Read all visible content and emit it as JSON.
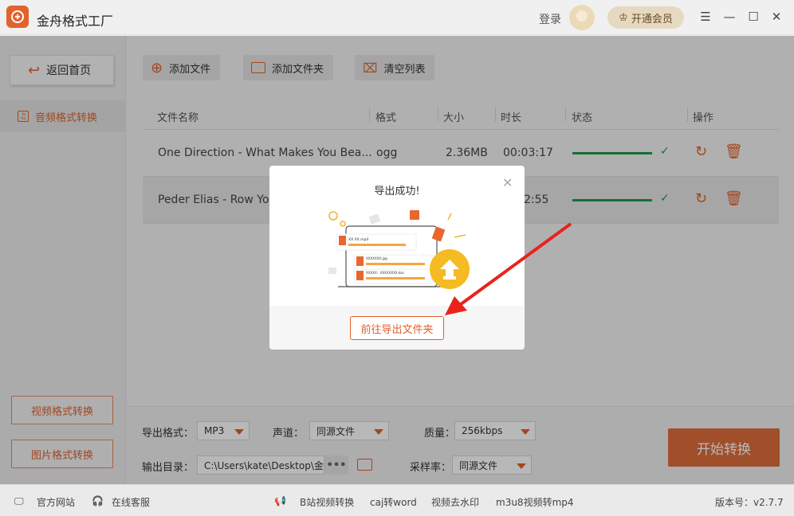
{
  "app": {
    "title": "金舟格式工厂",
    "login": "登录",
    "vip": "开通会员"
  },
  "sidebar": {
    "home": "返回首页",
    "active": "音频格式转换",
    "video": "视频格式转换",
    "image": "图片格式转换"
  },
  "toolbar": {
    "add_file": "添加文件",
    "add_folder": "添加文件夹",
    "clear": "清空列表"
  },
  "table": {
    "headers": {
      "name": "文件名称",
      "format": "格式",
      "size": "大小",
      "duration": "时长",
      "status": "状态",
      "action": "操作"
    },
    "rows": [
      {
        "name": "One Direction - What Makes You Bea...",
        "format": "ogg",
        "size": "2.36MB",
        "duration": "00:03:17",
        "progress": 1.0
      },
      {
        "name": "Peder Elias - Row You",
        "duration": "2:55",
        "progress": 1.0
      }
    ]
  },
  "settings": {
    "format_label": "导出格式：",
    "format_value": "MP3",
    "channel_label": "声道：",
    "channel_value": "同源文件",
    "quality_label": "质量：",
    "quality_value": "256kbps",
    "output_label": "输出目录：",
    "output_value": "C:\\Users\\kate\\Desktop\\金",
    "rate_label": "采样率：",
    "rate_value": "同源文件",
    "start": "开始转换"
  },
  "footer": {
    "site": "官方网站",
    "service": "在线客服",
    "bili": "B站视频转换",
    "caj": "caj转word",
    "watermark": "视频去水印",
    "m3u8": "m3u8视频转mp4",
    "version": "版本号：v2.7.7"
  },
  "dialog": {
    "title": "导出成功!",
    "button": "前往导出文件夹",
    "illu_file1": "XX XX.mp4",
    "illu_file2": "XXXXXXX.jpg",
    "illu_file3": "XXXXX：XXXXXXXX.doc"
  },
  "colors": {
    "accent": "#e2622c",
    "success": "#1d9a4a",
    "arrow": "#e8231c"
  }
}
